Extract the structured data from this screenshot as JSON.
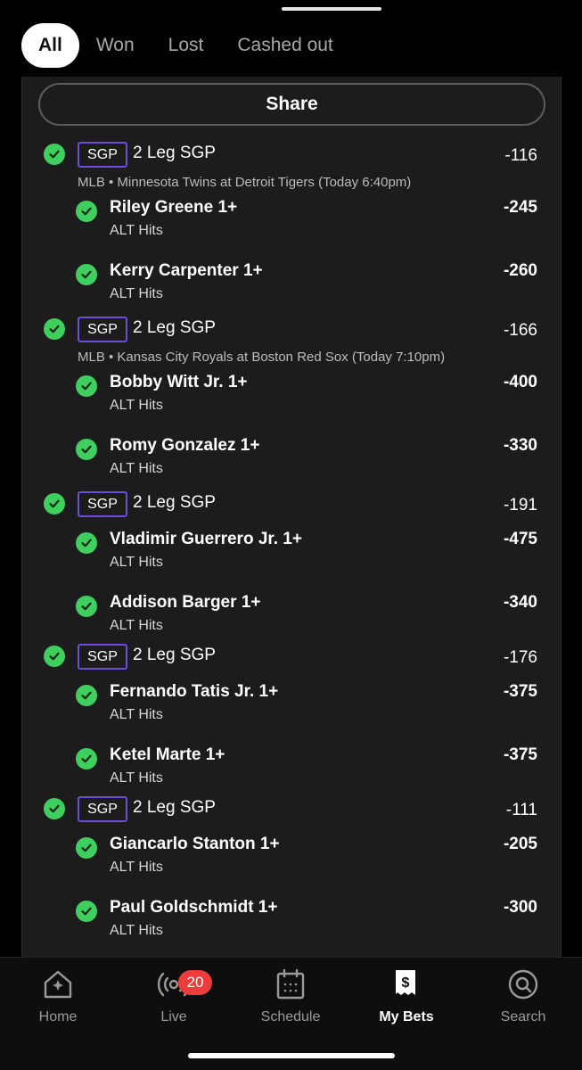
{
  "filters": [
    {
      "label": "All",
      "active": true
    },
    {
      "label": "Won",
      "active": false
    },
    {
      "label": "Lost",
      "active": false
    },
    {
      "label": "Cashed out",
      "active": false
    }
  ],
  "share_label": "Share",
  "bets": [
    {
      "tag": "SGP",
      "title": "2 Leg SGP",
      "odds": "-116",
      "game": "MLB • Minnesota Twins at Detroit Tigers (Today 6:40pm)",
      "legs": [
        {
          "name": "Riley Greene 1+",
          "market": "ALT Hits",
          "odds": "-245"
        },
        {
          "name": "Kerry Carpenter 1+",
          "market": "ALT Hits",
          "odds": "-260"
        }
      ]
    },
    {
      "tag": "SGP",
      "title": "2 Leg SGP",
      "odds": "-166",
      "game": "MLB • Kansas City Royals at Boston Red Sox (Today 7:10pm)",
      "legs": [
        {
          "name": "Bobby Witt Jr. 1+",
          "market": "ALT Hits",
          "odds": "-400"
        },
        {
          "name": "Romy Gonzalez 1+",
          "market": "ALT Hits",
          "odds": "-330"
        }
      ]
    },
    {
      "tag": "SGP",
      "title": "2 Leg SGP",
      "odds": "-191",
      "game": "",
      "legs": [
        {
          "name": "Vladimir Guerrero Jr. 1+",
          "market": "ALT Hits",
          "odds": "-475"
        },
        {
          "name": "Addison Barger 1+",
          "market": "ALT Hits",
          "odds": "-340"
        }
      ]
    },
    {
      "tag": "SGP",
      "title": "2 Leg SGP",
      "odds": "-176",
      "game": "",
      "legs": [
        {
          "name": "Fernando Tatis Jr. 1+",
          "market": "ALT Hits",
          "odds": "-375"
        },
        {
          "name": "Ketel Marte 1+",
          "market": "ALT Hits",
          "odds": "-375"
        }
      ]
    },
    {
      "tag": "SGP",
      "title": "2 Leg SGP",
      "odds": "-111",
      "game": "",
      "legs": [
        {
          "name": "Giancarlo Stanton 1+",
          "market": "ALT Hits",
          "odds": "-205"
        },
        {
          "name": "Paul Goldschmidt 1+",
          "market": "ALT Hits",
          "odds": "-300"
        }
      ]
    }
  ],
  "tabs": [
    {
      "label": "Home",
      "icon": "home-icon",
      "active": false
    },
    {
      "label": "Live",
      "icon": "live-icon",
      "active": false,
      "badge": "20"
    },
    {
      "label": "Schedule",
      "icon": "schedule-icon",
      "active": false
    },
    {
      "label": "My Bets",
      "icon": "my-bets-icon",
      "active": true
    },
    {
      "label": "Search",
      "icon": "search-icon",
      "active": false
    }
  ],
  "colors": {
    "check": "#3fcf5f",
    "sgp_border": "#6d4bdc",
    "badge": "#ee3b3b"
  }
}
